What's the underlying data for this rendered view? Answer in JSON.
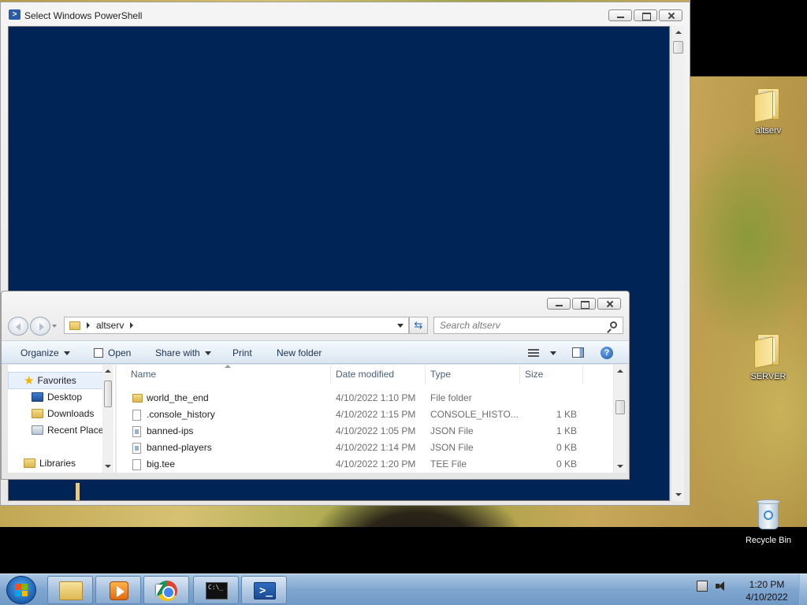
{
  "colors": {
    "console_bg": "#012456",
    "accent": "#2a6ab8"
  },
  "powershell": {
    "title": "Select Windows PowerShell"
  },
  "explorer": {
    "address": {
      "folder": "altserv"
    },
    "search": {
      "placeholder": "Search altserv"
    },
    "toolbar": {
      "organize": "Organize",
      "open": "Open",
      "share_with": "Share with",
      "print": "Print",
      "new_folder": "New folder"
    },
    "nav": {
      "favorites": "Favorites",
      "desktop": "Desktop",
      "downloads": "Downloads",
      "recent_places": "Recent Place",
      "libraries": "Libraries"
    },
    "columns": {
      "name": "Name",
      "date": "Date modified",
      "type": "Type",
      "size": "Size"
    },
    "rows": [
      {
        "name": "world_the_end",
        "date": "4/10/2022 1:10 PM",
        "type": "File folder",
        "size": "",
        "icon": "folder-icon"
      },
      {
        "name": ".console_history",
        "date": "4/10/2022 1:15 PM",
        "type": "CONSOLE_HISTO...",
        "size": "1 KB",
        "icon": "file-icon"
      },
      {
        "name": "banned-ips",
        "date": "4/10/2022 1:05 PM",
        "type": "JSON File",
        "size": "1 KB",
        "icon": "json-file-icon"
      },
      {
        "name": "banned-players",
        "date": "4/10/2022 1:14 PM",
        "type": "JSON File",
        "size": "0 KB",
        "icon": "json-file-icon"
      },
      {
        "name": "big.tee",
        "date": "4/10/2022 1:20 PM",
        "type": "TEE File",
        "size": "0 KB",
        "icon": "file-icon"
      }
    ]
  },
  "desktop_icons": {
    "altserv": "altserv",
    "server": "SERVER",
    "recycle_bin": "Recycle Bin"
  },
  "taskbar": {
    "time": "1:20 PM",
    "date": "4/10/2022",
    "cmd_label": "C:\\_"
  }
}
